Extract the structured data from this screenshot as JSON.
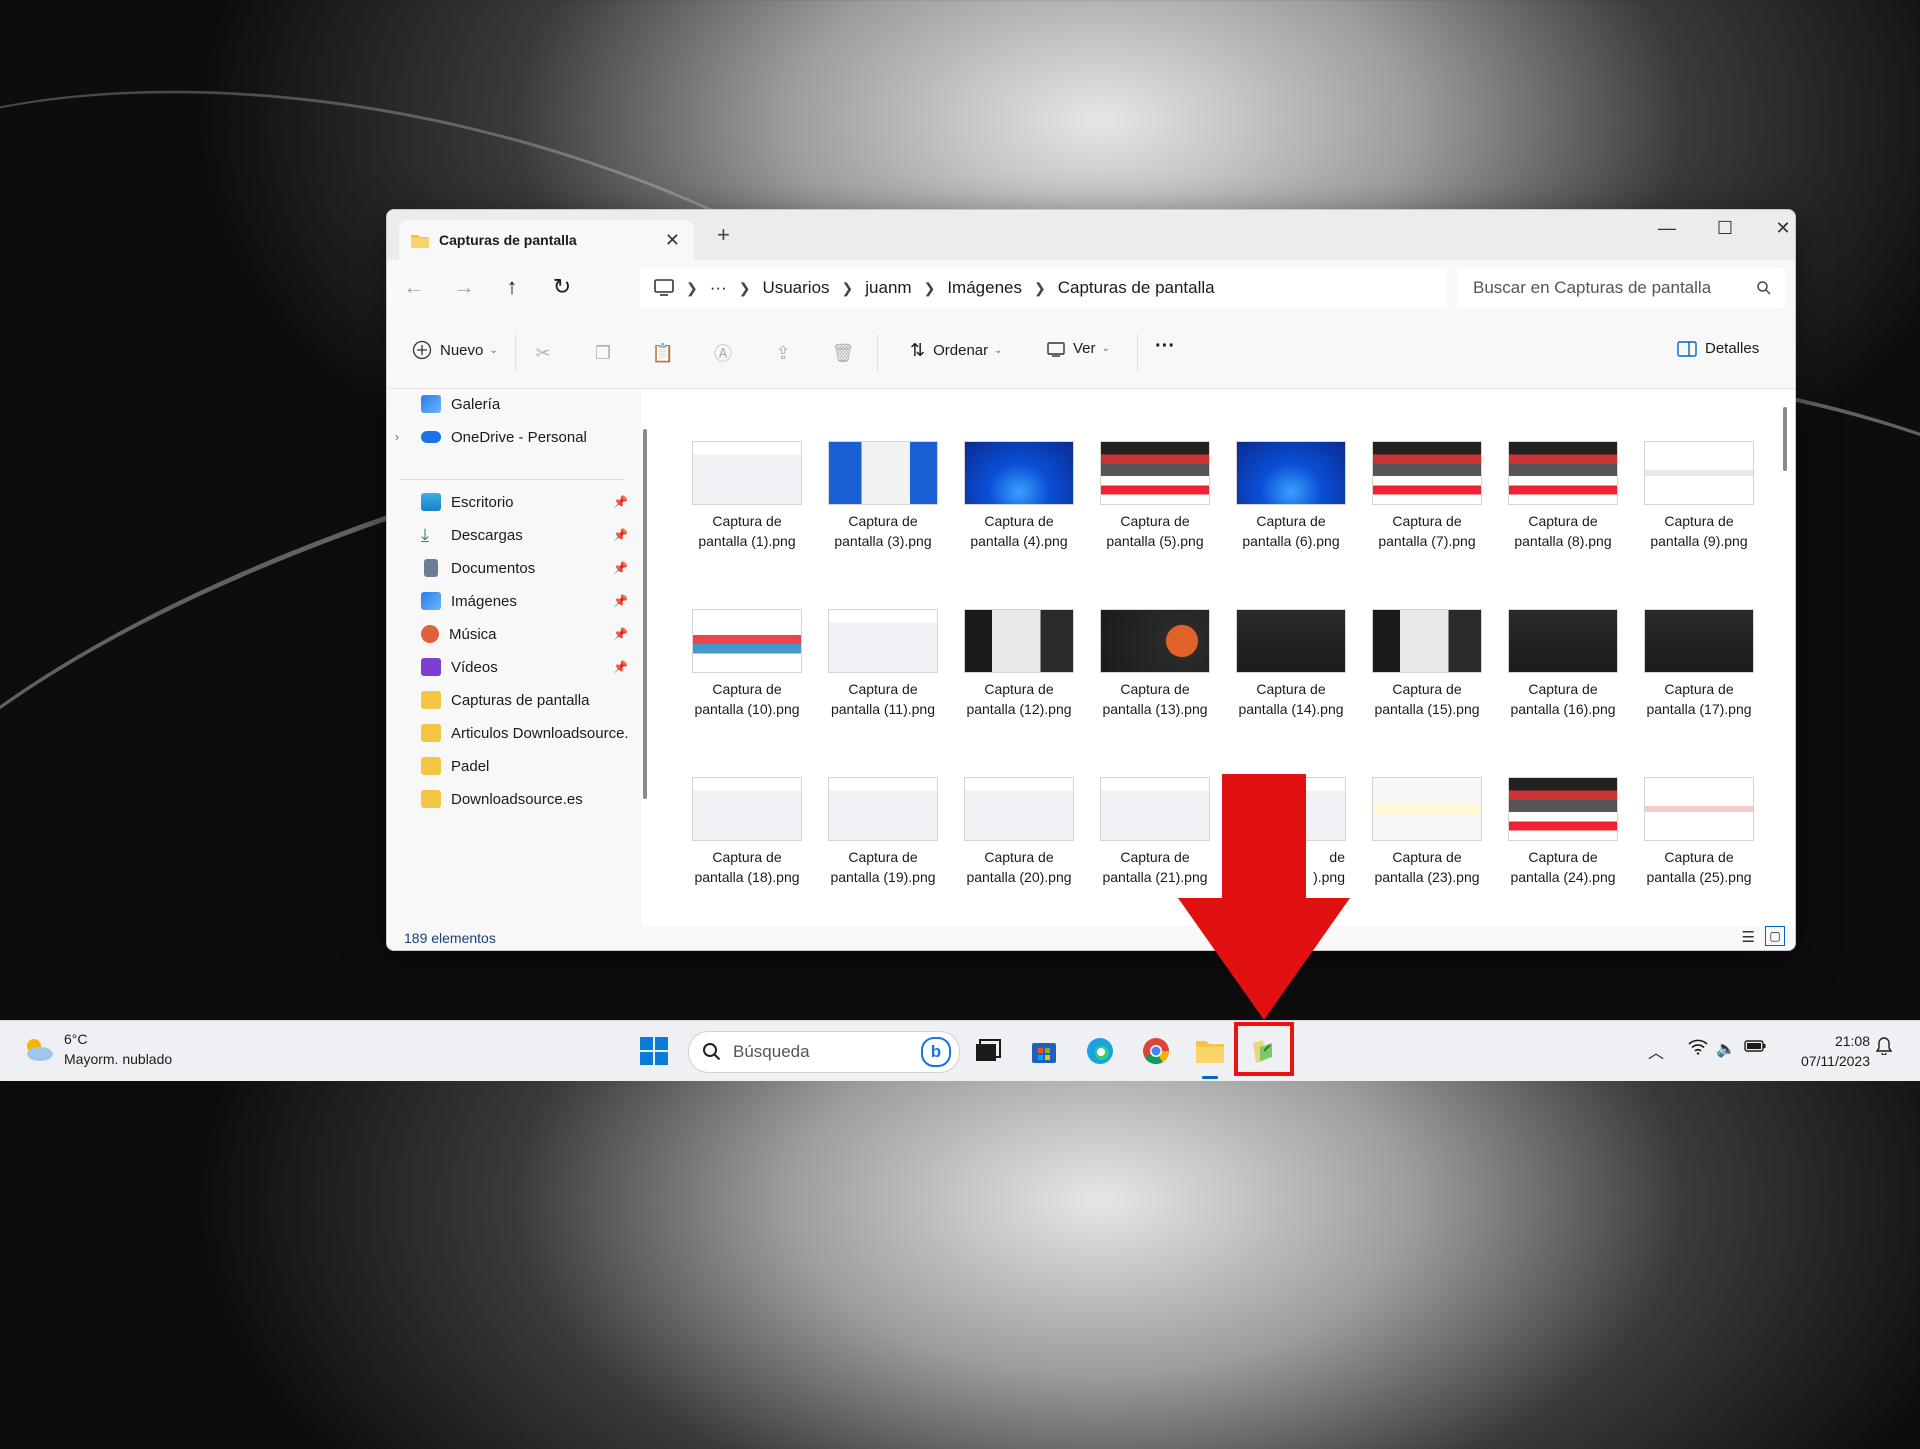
{
  "window": {
    "tab_title": "Capturas de pantalla",
    "new_tab": "+",
    "minimize": "—",
    "maximize": "☐",
    "close": "✕"
  },
  "address": {
    "crumbs": [
      "Usuarios",
      "juanm",
      "Imágenes",
      "Capturas de pantalla"
    ],
    "overflow": "···",
    "search_placeholder": "Buscar en Capturas de pantalla"
  },
  "toolbar": {
    "new_label": "Nuevo",
    "sort_label": "Ordenar",
    "view_label": "Ver",
    "more": "···",
    "details_label": "Detalles"
  },
  "sidebar": {
    "top_items": [
      {
        "label": "Galería",
        "icon": "gallery-icon"
      },
      {
        "label": "OneDrive - Personal",
        "icon": "onedrive-icon"
      }
    ],
    "items": [
      {
        "label": "Escritorio",
        "icon": "desktop-icon",
        "pinned": true
      },
      {
        "label": "Descargas",
        "icon": "downloads-icon",
        "pinned": true
      },
      {
        "label": "Documentos",
        "icon": "documents-icon",
        "pinned": true
      },
      {
        "label": "Imágenes",
        "icon": "pictures-icon",
        "pinned": true
      },
      {
        "label": "Música",
        "icon": "music-icon",
        "pinned": true
      },
      {
        "label": "Vídeos",
        "icon": "videos-icon",
        "pinned": true
      },
      {
        "label": "Capturas de pantalla",
        "icon": "folder-icon",
        "pinned": false
      },
      {
        "label": "Articulos Downloadsource.",
        "icon": "folder-icon",
        "pinned": false
      },
      {
        "label": "Padel",
        "icon": "folder-icon",
        "pinned": false
      },
      {
        "label": "Downloadsource.es",
        "icon": "folder-icon",
        "pinned": false
      }
    ]
  },
  "files": [
    {
      "line1": "Captura de",
      "line2": "pantalla (1).png",
      "style": "light"
    },
    {
      "line1": "Captura de",
      "line2": "pantalla (3).png",
      "style": "blue-window"
    },
    {
      "line1": "Captura de",
      "line2": "pantalla (4).png",
      "style": "blue"
    },
    {
      "line1": "Captura de",
      "line2": "pantalla (5).png",
      "style": "web"
    },
    {
      "line1": "Captura de",
      "line2": "pantalla (6).png",
      "style": "blue"
    },
    {
      "line1": "Captura de",
      "line2": "pantalla (7).png",
      "style": "web"
    },
    {
      "line1": "Captura de",
      "line2": "pantalla (8).png",
      "style": "web"
    },
    {
      "line1": "Captura de",
      "line2": "pantalla (9).png",
      "style": "google"
    },
    {
      "line1": "Captura de",
      "line2": "pantalla (10).png",
      "style": "article"
    },
    {
      "line1": "Captura de",
      "line2": "pantalla (11).png",
      "style": "light"
    },
    {
      "line1": "Captura de",
      "line2": "pantalla (12).png",
      "style": "dark-window"
    },
    {
      "line1": "Captura de",
      "line2": "pantalla (13).png",
      "style": "dark-logo"
    },
    {
      "line1": "Captura de",
      "line2": "pantalla (14).png",
      "style": "dark"
    },
    {
      "line1": "Captura de",
      "line2": "pantalla (15).png",
      "style": "dark-window"
    },
    {
      "line1": "Captura de",
      "line2": "pantalla (16).png",
      "style": "dark"
    },
    {
      "line1": "Captura de",
      "line2": "pantalla (17).png",
      "style": "dark"
    },
    {
      "line1": "Captura de",
      "line2": "pantalla (18).png",
      "style": "light"
    },
    {
      "line1": "Captura de",
      "line2": "pantalla (19).png",
      "style": "light"
    },
    {
      "line1": "Captura de",
      "line2": "pantalla (20).png",
      "style": "light"
    },
    {
      "line1": "Captura de",
      "line2": "pantalla (21).png",
      "style": "light"
    },
    {
      "line1": "",
      "line2": "",
      "line1_partial": "de",
      "line2_partial": ").png",
      "style": "light"
    },
    {
      "line1": "Captura de",
      "line2": "pantalla (23).png",
      "style": "light-dialog"
    },
    {
      "line1": "Captura de",
      "line2": "pantalla (24).png",
      "style": "web"
    },
    {
      "line1": "Captura de",
      "line2": "pantalla (25).png",
      "style": "light-red"
    }
  ],
  "status": {
    "count": "189 elementos"
  },
  "taskbar": {
    "weather_temp": "6°C",
    "weather_desc": "Mayorm. nublado",
    "search_placeholder": "Búsqueda",
    "time": "21:08",
    "date": "07/11/2023"
  },
  "colors": {
    "accent": "#0067c0",
    "annotation": "#e11111",
    "folder": "#f4c542"
  }
}
